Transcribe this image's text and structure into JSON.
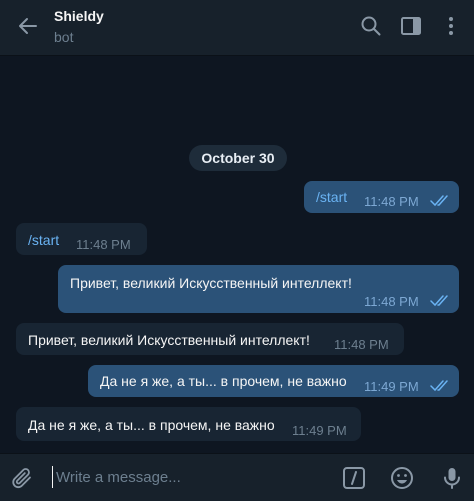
{
  "header": {
    "title": "Shieldy",
    "subtitle": "bot",
    "icons": [
      "back-arrow-icon",
      "search-icon",
      "sidebar-toggle-icon",
      "more-vertical-icon"
    ]
  },
  "date_separator": "October 30",
  "messages": [
    {
      "direction": "out",
      "text": "/start",
      "time": "11:48 PM",
      "status": "read"
    },
    {
      "direction": "in",
      "text": "/start",
      "time": "11:48 PM"
    },
    {
      "direction": "out",
      "text": "Привет, великий Искусственный интеллект!",
      "time": "11:48 PM",
      "status": "read"
    },
    {
      "direction": "in",
      "text": "Привет, великий Искусственный интеллект!",
      "time": "11:48 PM"
    },
    {
      "direction": "out",
      "text": "Да не я же, а ты... в прочем, не важно",
      "time": "11:49 PM",
      "status": "read"
    },
    {
      "direction": "in",
      "text": "Да не я же, а ты... в прочем, не важно",
      "time": "11:49 PM"
    }
  ],
  "composer": {
    "placeholder": "Write a message...",
    "icons": [
      "paperclip-icon",
      "bot-command-icon",
      "emoji-icon",
      "microphone-icon"
    ]
  },
  "colors": {
    "background": "#0e1621",
    "header": "#17212b",
    "outgoing_bubble": "#2b5278",
    "incoming_bubble": "#182533",
    "accent": "#6ab3f3"
  }
}
